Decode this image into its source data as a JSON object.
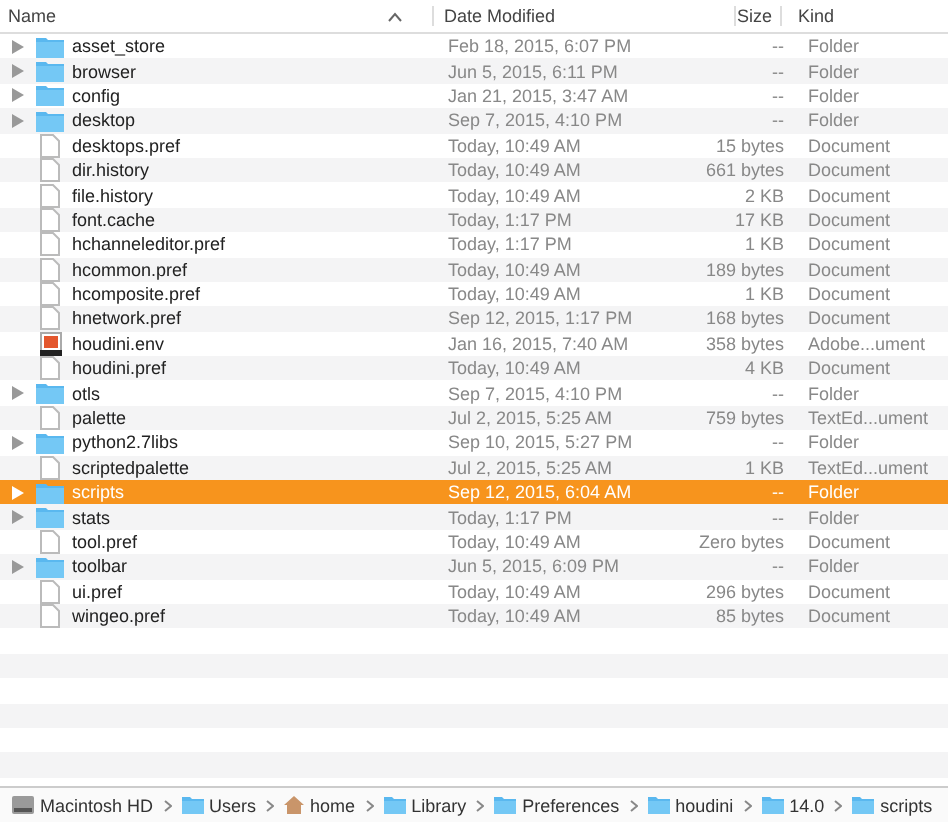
{
  "columns": {
    "name": "Name",
    "date": "Date Modified",
    "size": "Size",
    "kind": "Kind"
  },
  "rows": [
    {
      "name": "asset_store",
      "date": "Feb 18, 2015, 6:07 PM",
      "size": "--",
      "kind_text": "Folder",
      "kind": "folder",
      "selected": false
    },
    {
      "name": "browser",
      "date": "Jun 5, 2015, 6:11 PM",
      "size": "--",
      "kind_text": "Folder",
      "kind": "folder",
      "selected": false
    },
    {
      "name": "config",
      "date": "Jan 21, 2015, 3:47 AM",
      "size": "--",
      "kind_text": "Folder",
      "kind": "folder",
      "selected": false
    },
    {
      "name": "desktop",
      "date": "Sep 7, 2015, 4:10 PM",
      "size": "--",
      "kind_text": "Folder",
      "kind": "folder",
      "selected": false
    },
    {
      "name": "desktops.pref",
      "date": "Today, 10:49 AM",
      "size": "15 bytes",
      "kind_text": "Document",
      "kind": "document",
      "selected": false
    },
    {
      "name": "dir.history",
      "date": "Today, 10:49 AM",
      "size": "661 bytes",
      "kind_text": "Document",
      "kind": "document",
      "selected": false
    },
    {
      "name": "file.history",
      "date": "Today, 10:49 AM",
      "size": "2 KB",
      "kind_text": "Document",
      "kind": "document",
      "selected": false
    },
    {
      "name": "font.cache",
      "date": "Today, 1:17 PM",
      "size": "17 KB",
      "kind_text": "Document",
      "kind": "document",
      "selected": false
    },
    {
      "name": "hchanneleditor.pref",
      "date": "Today, 1:17 PM",
      "size": "1 KB",
      "kind_text": "Document",
      "kind": "document",
      "selected": false
    },
    {
      "name": "hcommon.pref",
      "date": "Today, 10:49 AM",
      "size": "189 bytes",
      "kind_text": "Document",
      "kind": "document",
      "selected": false
    },
    {
      "name": "hcomposite.pref",
      "date": "Today, 10:49 AM",
      "size": "1 KB",
      "kind_text": "Document",
      "kind": "document",
      "selected": false
    },
    {
      "name": "hnetwork.pref",
      "date": "Sep 12, 2015, 1:17 PM",
      "size": "168 bytes",
      "kind_text": "Document",
      "kind": "document",
      "selected": false
    },
    {
      "name": "houdini.env",
      "date": "Jan 16, 2015, 7:40 AM",
      "size": "358 bytes",
      "kind_text": "Adobe...ument",
      "kind": "app-document",
      "selected": false
    },
    {
      "name": "houdini.pref",
      "date": "Today, 10:49 AM",
      "size": "4 KB",
      "kind_text": "Document",
      "kind": "document",
      "selected": false
    },
    {
      "name": "otls",
      "date": "Sep 7, 2015, 4:10 PM",
      "size": "--",
      "kind_text": "Folder",
      "kind": "folder",
      "selected": false
    },
    {
      "name": "palette",
      "date": "Jul 2, 2015, 5:25 AM",
      "size": "759 bytes",
      "kind_text": "TextEd...ument",
      "kind": "document",
      "selected": false
    },
    {
      "name": "python2.7libs",
      "date": "Sep 10, 2015, 5:27 PM",
      "size": "--",
      "kind_text": "Folder",
      "kind": "folder",
      "selected": false
    },
    {
      "name": "scriptedpalette",
      "date": "Jul 2, 2015, 5:25 AM",
      "size": "1 KB",
      "kind_text": "TextEd...ument",
      "kind": "document",
      "selected": false
    },
    {
      "name": "scripts",
      "date": "Sep 12, 2015, 6:04 AM",
      "size": "--",
      "kind_text": "Folder",
      "kind": "folder",
      "selected": true
    },
    {
      "name": "stats",
      "date": "Today, 1:17 PM",
      "size": "--",
      "kind_text": "Folder",
      "kind": "folder",
      "selected": false
    },
    {
      "name": "tool.pref",
      "date": "Today, 10:49 AM",
      "size": "Zero bytes",
      "kind_text": "Document",
      "kind": "document",
      "selected": false
    },
    {
      "name": "toolbar",
      "date": "Jun 5, 2015, 6:09 PM",
      "size": "--",
      "kind_text": "Folder",
      "kind": "folder",
      "selected": false
    },
    {
      "name": "ui.pref",
      "date": "Today, 10:49 AM",
      "size": "296 bytes",
      "kind_text": "Document",
      "kind": "document",
      "selected": false
    },
    {
      "name": "wingeo.pref",
      "date": "Today, 10:49 AM",
      "size": "85 bytes",
      "kind_text": "Document",
      "kind": "document",
      "selected": false
    }
  ],
  "path_bar": [
    {
      "label": "Macintosh HD",
      "kind": "disk"
    },
    {
      "label": "Users",
      "kind": "folder"
    },
    {
      "label": "home",
      "kind": "home"
    },
    {
      "label": "Library",
      "kind": "folder"
    },
    {
      "label": "Preferences",
      "kind": "folder"
    },
    {
      "label": "houdini",
      "kind": "folder"
    },
    {
      "label": "14.0",
      "kind": "folder"
    },
    {
      "label": "scripts",
      "kind": "folder"
    }
  ]
}
